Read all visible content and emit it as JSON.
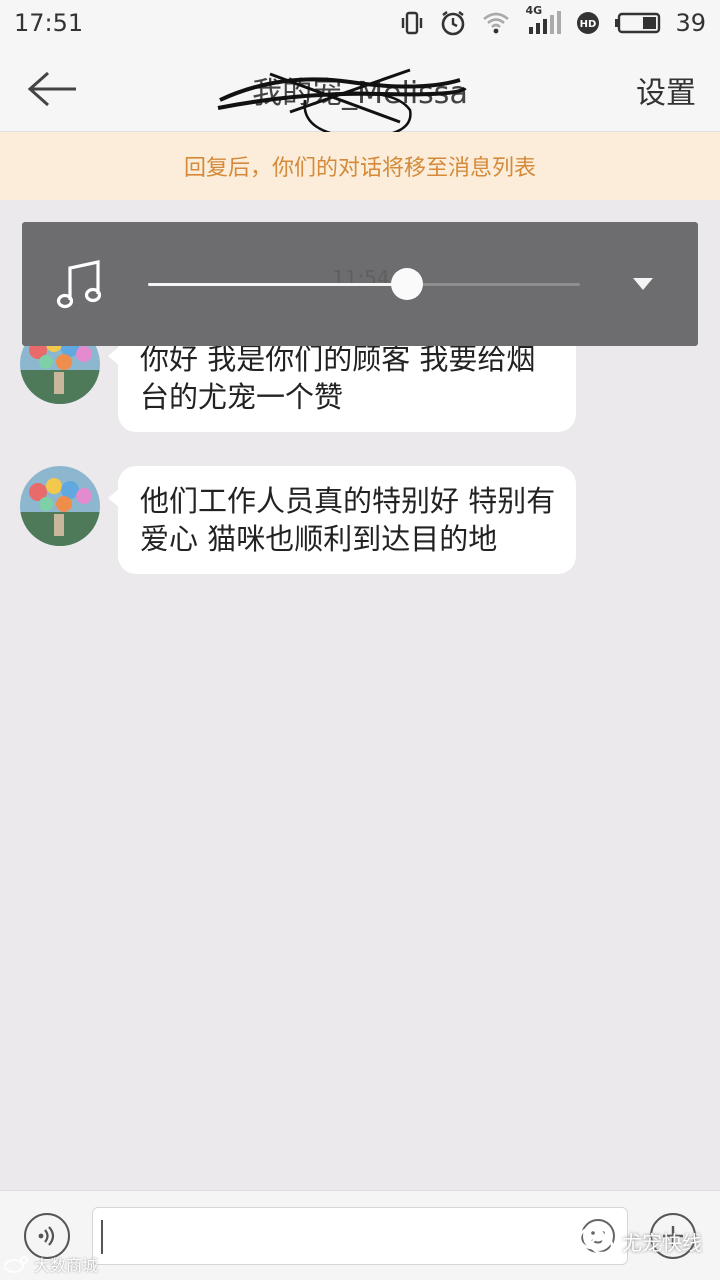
{
  "status_bar": {
    "time": "17:51",
    "network": "4G",
    "battery": "39",
    "icons": [
      "vibrate-icon",
      "alarm-icon",
      "wifi-icon",
      "signal-icon",
      "hd-icon",
      "battery-icon"
    ]
  },
  "header": {
    "title": "我的宠_Melissa",
    "settings_label": "设置"
  },
  "notice": {
    "text": "回复后，你们的对话将移至消息列表"
  },
  "player": {
    "time": "11:54",
    "progress": 0.6
  },
  "messages": [
    {
      "text": "你好 我是你们的顾客 我要给烟台的尤宠一个赞"
    },
    {
      "text": "他们工作人员真的特别好 特别有爱心 猫咪也顺利到达目的地"
    }
  ],
  "input": {
    "placeholder": ""
  },
  "watermarks": {
    "left": "大数商城",
    "right": "尤宠快线"
  },
  "colors": {
    "notice_text": "#d48a3a",
    "notice_bg": "#fbedd9",
    "player_bg": "#6d6c6e",
    "page_bg": "#ebe9ec"
  }
}
